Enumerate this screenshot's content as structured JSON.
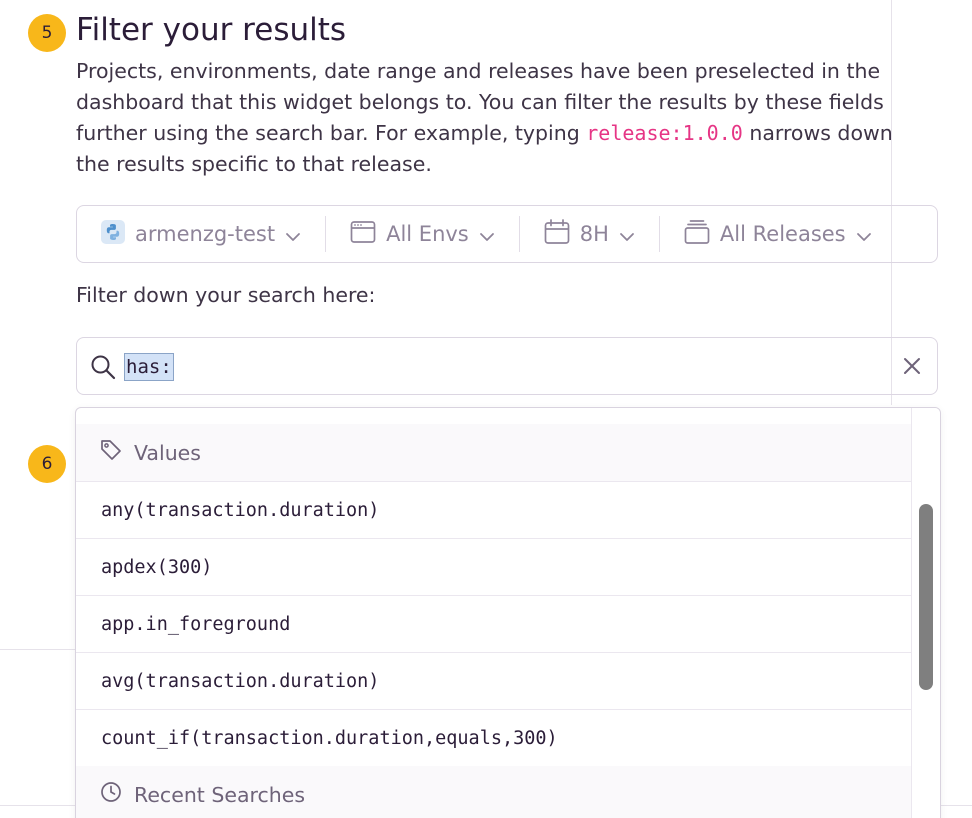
{
  "steps": {
    "step5": "5",
    "step6": "6"
  },
  "section": {
    "title": "Filter your results",
    "desc_part1": "Projects, environments, date range and releases have been preselected in the dashboard that this widget belongs to. You can filter the results by these fields further using the search bar. For example, typing ",
    "desc_code": "release:1.0.0",
    "desc_part2": " narrows down the results specific to that release."
  },
  "filters": {
    "project": "armenzg-test",
    "environment": "All Envs",
    "date_range": "8H",
    "release": "All Releases"
  },
  "search": {
    "label": "Filter down your search here:",
    "token": "has:"
  },
  "dropdown": {
    "values_header": "Values",
    "items": [
      "any(transaction.duration)",
      "apdex(300)",
      "app.in_foreground",
      "avg(transaction.duration)",
      "count_if(transaction.duration,equals,300)"
    ],
    "recent_header": "Recent Searches"
  },
  "colors": {
    "accent_badge": "#f8b71a",
    "code_pink": "#e63585",
    "token_bg": "#d3e2f7"
  },
  "icons": {
    "project": "python-icon",
    "environment": "window-icon",
    "date": "calendar-icon",
    "release": "package-icon",
    "search": "search-icon",
    "clear": "close-icon",
    "values": "tag-icon",
    "recent": "clock-icon"
  }
}
